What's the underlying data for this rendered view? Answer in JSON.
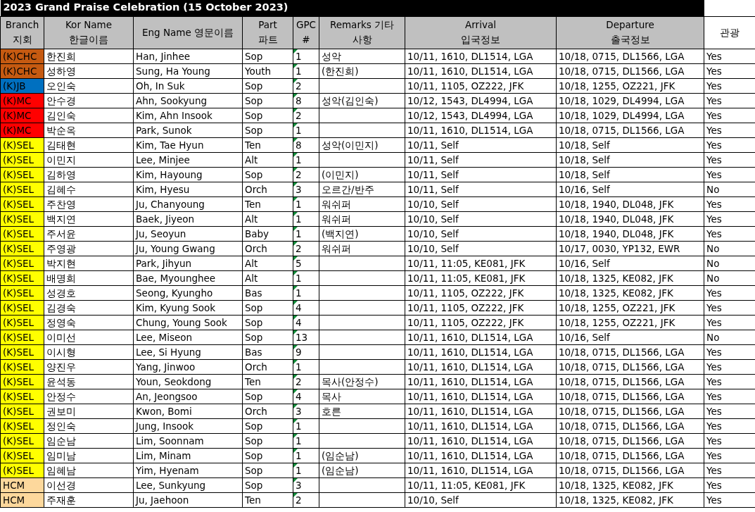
{
  "title": "2023 Grand Praise Celebration (15 October 2023)",
  "columns": [
    {
      "lines": [
        "Branch",
        "지회"
      ],
      "shaded": true
    },
    {
      "lines": [
        "Kor Name",
        "한글이름"
      ],
      "shaded": true
    },
    {
      "lines": [
        "Eng Name 영문이름"
      ],
      "shaded": true
    },
    {
      "lines": [
        "Part",
        "파트"
      ],
      "shaded": true
    },
    {
      "lines": [
        "GPC",
        "#"
      ],
      "shaded": true
    },
    {
      "lines": [
        "Remarks 기타",
        "사항"
      ],
      "shaded": true
    },
    {
      "lines": [
        "Arrival",
        "입국정보"
      ],
      "shaded": true
    },
    {
      "lines": [
        "Departure",
        "출국정보"
      ],
      "shaded": true
    },
    {
      "lines": [
        "관광"
      ],
      "shaded": false
    }
  ],
  "rows": [
    {
      "branch": "(K)CHC",
      "color": "#c55a11",
      "kor": "한진희",
      "eng": "Han, Jinhee",
      "part": "Sop",
      "gpc": "1",
      "remarks": "성악",
      "arrival": "10/11, 1610, DL1514, LGA",
      "departure": "10/18, 0715, DL1566, LGA",
      "tour": "Yes"
    },
    {
      "branch": "(K)CHC",
      "color": "#c55a11",
      "kor": "성하영",
      "eng": "Sung, Ha Young",
      "part": "Youth",
      "gpc": "1",
      "remarks": "(한진희)",
      "arrival": "10/11, 1610, DL1514, LGA",
      "departure": "10/18, 0715, DL1566, LGA",
      "tour": "Yes"
    },
    {
      "branch": "(K)JB",
      "color": "#0070c0",
      "kor": "오인숙",
      "eng": "Oh, In Suk",
      "part": "Sop",
      "gpc": "2",
      "arrival": "10/11, 1105, OZ222, JFK",
      "departure": "10/18, 1255, OZ221, JFK",
      "tour": "Yes"
    },
    {
      "branch": "(K)MC",
      "color": "#ff0000",
      "kor": "안수경",
      "eng": "Ahn, Sookyung",
      "part": "Sop",
      "gpc": "8",
      "remarks": "성악(김인숙)",
      "arrival": "10/12, 1543, DL4994, LGA",
      "departure": "10/18, 1029, DL4994, LGA",
      "tour": "Yes"
    },
    {
      "branch": "(K)MC",
      "color": "#ff0000",
      "kor": "김인숙",
      "eng": "Kim, Ahn Insook",
      "part": "Sop",
      "gpc": "2",
      "arrival": "10/12, 1543, DL4994, LGA",
      "departure": "10/18, 1029, DL4994, LGA",
      "tour": "Yes"
    },
    {
      "branch": "(K)MC",
      "color": "#ff0000",
      "kor": "박순옥",
      "eng": "Park, Sunok",
      "part": "Sop",
      "gpc": "1",
      "arrival": "10/11, 1610, DL1514, LGA",
      "departure": "10/18, 0715, DL1566, LGA",
      "tour": "Yes"
    },
    {
      "branch": "(K)SEL",
      "color": "#ffff00",
      "kor": "김태현",
      "eng": "Kim, Tae Hyun",
      "part": "Ten",
      "gpc": "8",
      "remarks": "성악(이민지)",
      "arrival": "10/11, Self",
      "departure": "10/18, Self",
      "tour": "Yes"
    },
    {
      "branch": "(K)SEL",
      "color": "#ffff00",
      "kor": "이민지",
      "eng": "Lee, Minjee",
      "part": "Alt",
      "gpc": "1",
      "arrival": "10/11, Self",
      "departure": "10/18, Self",
      "tour": "Yes"
    },
    {
      "branch": "(K)SEL",
      "color": "#ffff00",
      "kor": "김하영",
      "eng": "Kim, Hayoung",
      "part": "Sop",
      "gpc": "2",
      "remarks": "(이민지)",
      "arrival": "10/11, Self",
      "departure": "10/18, Self",
      "tour": "Yes"
    },
    {
      "branch": "(K)SEL",
      "color": "#ffff00",
      "kor": "김혜수",
      "eng": "Kim, Hyesu",
      "part": "Orch",
      "gpc": "3",
      "remarks": "오르간/반주",
      "arrival": "10/11, Self",
      "departure": "10/16, Self",
      "tour": "No"
    },
    {
      "branch": "(K)SEL",
      "color": "#ffff00",
      "kor": "주찬영",
      "eng": "Ju, Chanyoung",
      "part": "Ten",
      "gpc": "1",
      "remarks": "워쉬퍼",
      "arrival": "10/10, Self",
      "departure": "10/18, 1940, DL048, JFK",
      "tour": "Yes"
    },
    {
      "branch": "(K)SEL",
      "color": "#ffff00",
      "kor": "백지연",
      "eng": "Baek, Jiyeon",
      "part": "Alt",
      "gpc": "1",
      "remarks": "워쉬퍼",
      "arrival": "10/10, Self",
      "departure": "10/18, 1940, DL048, JFK",
      "tour": "Yes"
    },
    {
      "branch": "(K)SEL",
      "color": "#ffff00",
      "kor": "주서윤",
      "eng": "Ju, Seoyun",
      "part": "Baby",
      "gpc": "1",
      "remarks": "(백지연)",
      "arrival": "10/10, Self",
      "departure": "10/18, 1940, DL048, JFK",
      "tour": "Yes"
    },
    {
      "branch": "(K)SEL",
      "color": "#ffff00",
      "kor": "주영광",
      "eng": "Ju, Young Gwang",
      "part": "Orch",
      "gpc": "2",
      "remarks": "워쉬퍼",
      "arrival": "10/10, Self",
      "departure": "10/17, 0030, YP132, EWR",
      "tour": "No"
    },
    {
      "branch": "(K)SEL",
      "color": "#ffff00",
      "kor": "박지현",
      "eng": "Park, Jihyun",
      "part": "Alt",
      "gpc": "5",
      "arrival": "10/11, 11:05, KE081, JFK",
      "departure": "10/16, Self",
      "tour": "No"
    },
    {
      "branch": "(K)SEL",
      "color": "#ffff00",
      "kor": "배명희",
      "eng": "Bae, Myounghee",
      "part": "Alt",
      "gpc": "1",
      "arrival": "10/11, 11:05, KE081, JFK",
      "departure": "10/18, 1325, KE082, JFK",
      "tour": "No"
    },
    {
      "branch": "(K)SEL",
      "color": "#ffff00",
      "kor": "성경호",
      "eng": "Seong, Kyungho",
      "part": "Bas",
      "gpc": "1",
      "arrival": "10/11, 1105, OZ222, JFK",
      "departure": "10/18, 1325, KE082, JFK",
      "tour": "Yes"
    },
    {
      "branch": "(K)SEL",
      "color": "#ffff00",
      "kor": "김경숙",
      "eng": "Kim, Kyung Sook",
      "part": "Sop",
      "gpc": "4",
      "arrival": "10/11, 1105, OZ222, JFK",
      "departure": "10/18, 1255, OZ221, JFK",
      "tour": "Yes"
    },
    {
      "branch": "(K)SEL",
      "color": "#ffff00",
      "kor": "정영숙",
      "eng": "Chung, Young Sook",
      "part": "Sop",
      "gpc": "4",
      "arrival": "10/11, 1105, OZ222, JFK",
      "departure": "10/18, 1255, OZ221, JFK",
      "tour": "Yes"
    },
    {
      "branch": "(K)SEL",
      "color": "#ffff00",
      "kor": "이미선",
      "eng": "Lee, Miseon",
      "part": "Sop",
      "gpc": "13",
      "arrival": "10/11, 1610, DL1514, LGA",
      "departure": "10/16, Self",
      "tour": "No"
    },
    {
      "branch": "(K)SEL",
      "color": "#ffff00",
      "kor": "이시형",
      "eng": "Lee, Si Hyung",
      "part": "Bas",
      "gpc": "9",
      "arrival": "10/11, 1610, DL1514, LGA",
      "departure": "10/18, 0715, DL1566, LGA",
      "tour": "Yes"
    },
    {
      "branch": "(K)SEL",
      "color": "#ffff00",
      "kor": "양진우",
      "eng": "Yang, Jinwoo",
      "part": "Orch",
      "gpc": "1",
      "arrival": "10/11, 1610, DL1514, LGA",
      "departure": "10/18, 0715, DL1566, LGA",
      "tour": "Yes"
    },
    {
      "branch": "(K)SEL",
      "color": "#ffff00",
      "kor": "윤석동",
      "eng": "Youn, Seokdong",
      "part": "Ten",
      "gpc": "2",
      "remarks": "목사(안정수)",
      "arrival": "10/11, 1610, DL1514, LGA",
      "departure": "10/18, 0715, DL1566, LGA",
      "tour": "Yes"
    },
    {
      "branch": "(K)SEL",
      "color": "#ffff00",
      "kor": "안정수",
      "eng": "An, Jeongsoo",
      "part": "Sop",
      "gpc": "4",
      "remarks": "목사",
      "arrival": "10/11, 1610, DL1514, LGA",
      "departure": "10/18, 0715, DL1566, LGA",
      "tour": "Yes"
    },
    {
      "branch": "(K)SEL",
      "color": "#ffff00",
      "kor": "권보미",
      "eng": "Kwon, Bomi",
      "part": "Orch",
      "gpc": "3",
      "remarks": "호른",
      "arrival": "10/11, 1610, DL1514, LGA",
      "departure": "10/18, 0715, DL1566, LGA",
      "tour": "Yes"
    },
    {
      "branch": "(K)SEL",
      "color": "#ffff00",
      "kor": "정인숙",
      "eng": "Jung, Insook",
      "part": "Sop",
      "gpc": "1",
      "arrival": "10/11, 1610, DL1514, LGA",
      "departure": "10/18, 0715, DL1566, LGA",
      "tour": "Yes"
    },
    {
      "branch": "(K)SEL",
      "color": "#ffff00",
      "kor": "임순남",
      "eng": "Lim, Soonnam",
      "part": "Sop",
      "gpc": "1",
      "arrival": "10/11, 1610, DL1514, LGA",
      "departure": "10/18, 0715, DL1566, LGA",
      "tour": "Yes"
    },
    {
      "branch": "(K)SEL",
      "color": "#ffff00",
      "kor": "임미남",
      "eng": "Lim, Minam",
      "part": "Sop",
      "gpc": "1",
      "remarks": "(임순남)",
      "arrival": "10/11, 1610, DL1514, LGA",
      "departure": "10/18, 0715, DL1566, LGA",
      "tour": "Yes"
    },
    {
      "branch": "(K)SEL",
      "color": "#ffff00",
      "kor": "임혜남",
      "eng": "Yim, Hyenam",
      "part": "Sop",
      "gpc": "1",
      "remarks": "(임순남)",
      "arrival": "10/11, 1610, DL1514, LGA",
      "departure": "10/18, 0715, DL1566, LGA",
      "tour": "Yes"
    },
    {
      "branch": "HCM",
      "color": "#fdd89c",
      "kor": "이선경",
      "eng": "Lee, Sunkyung",
      "part": "Sop",
      "gpc": "3",
      "arrival": "10/11, 11:05, KE081, JFK",
      "departure": "10/18, 1325, KE082, JFK",
      "tour": "Yes"
    },
    {
      "branch": "HCM",
      "color": "#fdd89c",
      "kor": "주재훈",
      "eng": "Ju, Jaehoon",
      "part": "Ten",
      "gpc": "2",
      "arrival": "10/10, Self",
      "departure": "10/18, 1325, KE082, JFK",
      "tour": "Yes"
    }
  ]
}
